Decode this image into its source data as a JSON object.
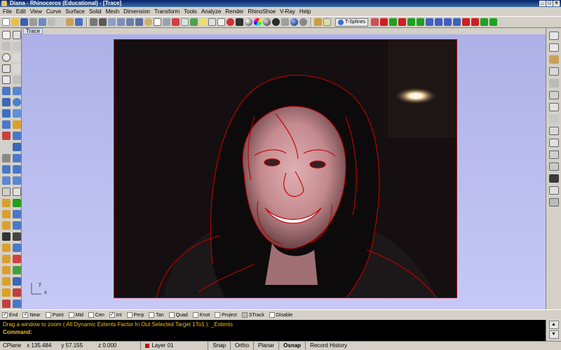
{
  "window": {
    "title": "Diana - Rhinoceros (Educational) - [Trace]"
  },
  "menu": [
    "File",
    "Edit",
    "View",
    "Curve",
    "Surface",
    "Solid",
    "Mesh",
    "Dimension",
    "Transform",
    "Tools",
    "Analyze",
    "Render",
    "RhinoShoe",
    "V-Ray",
    "Help"
  ],
  "toolbar": {
    "tsplines_label": "T-Splines"
  },
  "viewport": {
    "name": "Trace"
  },
  "axis": {
    "x": "x",
    "y": "y"
  },
  "osnaps": [
    {
      "label": "End",
      "checked": true
    },
    {
      "label": "Near",
      "checked": true
    },
    {
      "label": "Point",
      "checked": false
    },
    {
      "label": "Mid",
      "checked": false
    },
    {
      "label": "Cen",
      "checked": false
    },
    {
      "label": "Int",
      "checked": true
    },
    {
      "label": "Perp",
      "checked": false
    },
    {
      "label": "Tan",
      "checked": false
    },
    {
      "label": "Quad",
      "checked": false
    },
    {
      "label": "Knot",
      "checked": false
    },
    {
      "label": "Project",
      "checked": false
    },
    {
      "label": "STrack",
      "checked": false
    },
    {
      "label": "Disable",
      "checked": false
    }
  ],
  "command": {
    "history": "Drag a window to zoom ( All Dynamic Extents Factor In Out Selected Target 1To1 ): _Extents",
    "prompt": "Command:"
  },
  "status": {
    "cplane": "CPlane",
    "x": "x 135.484",
    "y": "y 57.155",
    "z": "z 0.000",
    "layer": "Layer 01",
    "panes": [
      {
        "label": "Snap",
        "active": false
      },
      {
        "label": "Ortho",
        "active": false
      },
      {
        "label": "Planar",
        "active": false
      },
      {
        "label": "Osnap",
        "active": true
      },
      {
        "label": "Record History",
        "active": false
      }
    ]
  },
  "colors": {
    "trace_curve": "#c00000",
    "viewport_bg": "#b8bbee",
    "command_bg": "#000000",
    "command_text": "#f0c020"
  }
}
